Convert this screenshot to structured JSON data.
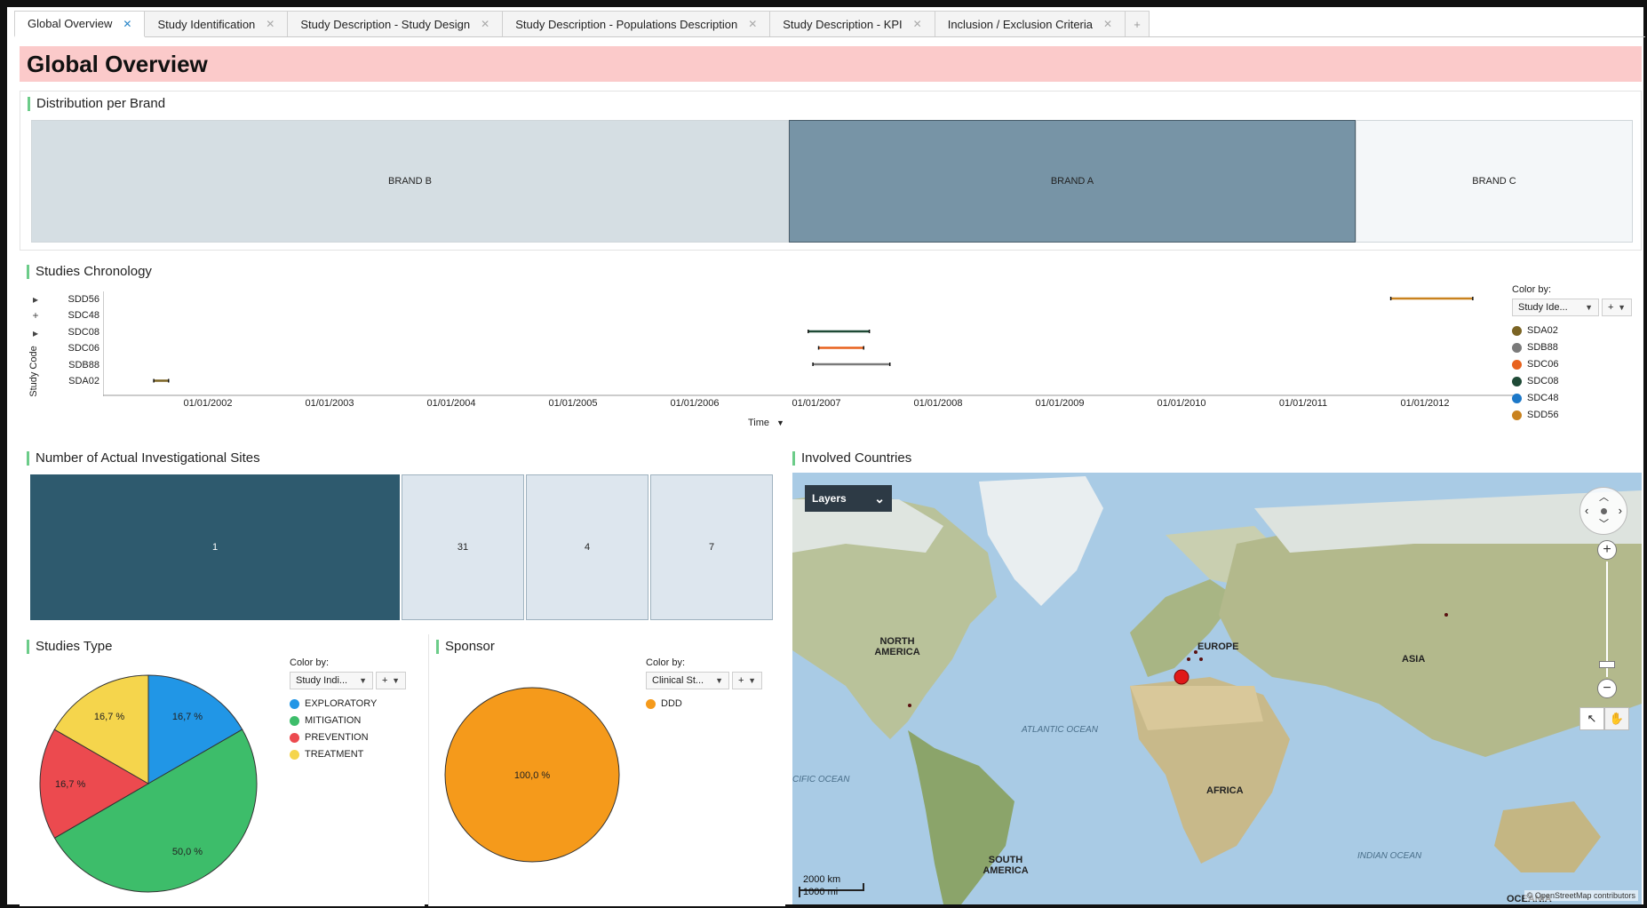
{
  "tabs": [
    {
      "label": "Global Overview",
      "active": true
    },
    {
      "label": "Study Identification"
    },
    {
      "label": "Study Description - Study Design"
    },
    {
      "label": "Study Description - Populations Description"
    },
    {
      "label": "Study Description - KPI"
    },
    {
      "label": "Inclusion / Exclusion Criteria"
    }
  ],
  "tab_add": "+",
  "page_title": "Global Overview",
  "brand_panel": {
    "title": "Distribution per Brand",
    "brands": [
      {
        "label": "BRAND B",
        "color": "#d5dee3"
      },
      {
        "label": "BRAND A",
        "color": "#7794a6"
      },
      {
        "label": "BRAND C",
        "color": "#f4f7f9"
      }
    ]
  },
  "chronology": {
    "title": "Studies Chronology",
    "ylabel": "Study Code",
    "xlabel": "Time",
    "color_by_label": "Color by:",
    "color_by_value": "Study Ide...",
    "studies": [
      "SDD56",
      "SDC48",
      "SDC08",
      "SDC06",
      "SDB88",
      "SDA02"
    ],
    "xticks": [
      "01/01/2002",
      "01/01/2003",
      "01/01/2004",
      "01/01/2005",
      "01/01/2006",
      "01/01/2007",
      "01/01/2008",
      "01/01/2009",
      "01/01/2010",
      "01/01/2011",
      "01/01/2012"
    ],
    "legend": [
      {
        "name": "SDA02",
        "color": "#7b6424"
      },
      {
        "name": "SDB88",
        "color": "#7a7a7a"
      },
      {
        "name": "SDC06",
        "color": "#e8621d"
      },
      {
        "name": "SDC08",
        "color": "#1f4a36"
      },
      {
        "name": "SDC48",
        "color": "#1c78c8"
      },
      {
        "name": "SDD56",
        "color": "#c9821f"
      }
    ]
  },
  "sites": {
    "title": "Number of Actual Investigational Sites",
    "values": [
      "1",
      "31",
      "4",
      "7"
    ]
  },
  "countries": {
    "title": "Involved Countries",
    "layers_label": "Layers",
    "labels": {
      "north_america": "NORTH AMERICA",
      "south_america": "SOUTH AMERICA",
      "europe": "EUROPE",
      "asia": "ASIA",
      "africa": "AFRICA",
      "oceania": "OCEANIA"
    },
    "oceans": {
      "atlantic": "ATLANTIC OCEAN",
      "pacific": "CIFIC OCEAN",
      "indian": "INDIAN OCEAN"
    },
    "scale_km": "2000 km",
    "scale_mi": "1000 mi",
    "attribution": "© OpenStreetMap contributors"
  },
  "studies_type": {
    "title": "Studies Type",
    "color_by_label": "Color by:",
    "color_by_value": "Study Indi...",
    "slices": [
      {
        "name": "EXPLORATORY",
        "value": 16.7,
        "label": "16,7 %",
        "color": "#2196e6"
      },
      {
        "name": "MITIGATION",
        "value": 50.0,
        "label": "50,0 %",
        "color": "#3dbd6a"
      },
      {
        "name": "PREVENTION",
        "value": 16.7,
        "label": "16,7 %",
        "color": "#ec4a4f"
      },
      {
        "name": "TREATMENT",
        "value": 16.7,
        "label": "16,7 %",
        "color": "#f5d54c"
      }
    ]
  },
  "sponsor": {
    "title": "Sponsor",
    "color_by_label": "Color by:",
    "color_by_value": "Clinical St...",
    "slices": [
      {
        "name": "DDD",
        "value": 100.0,
        "label": "100,0 %",
        "color": "#f59a1b"
      }
    ]
  },
  "chart_data": [
    {
      "type": "bar",
      "title": "Distribution per Brand",
      "categories": [
        "BRAND B",
        "BRAND A",
        "BRAND C"
      ]
    },
    {
      "type": "timeline",
      "title": "Studies Chronology",
      "xlabel": "Time",
      "ylabel": "Study Code",
      "series": [
        {
          "name": "SDD56",
          "start": "2011-07-01",
          "end": "2012-03-01"
        },
        {
          "name": "SDC08",
          "start": "2006-10-01",
          "end": "2007-04-01"
        },
        {
          "name": "SDC06",
          "start": "2006-11-01",
          "end": "2007-03-15"
        },
        {
          "name": "SDB88",
          "start": "2006-10-15",
          "end": "2007-06-01"
        },
        {
          "name": "SDA02",
          "start": "2001-06-01",
          "end": "2001-07-15"
        }
      ]
    },
    {
      "type": "pie",
      "title": "Studies Type",
      "categories": [
        "EXPLORATORY",
        "MITIGATION",
        "PREVENTION",
        "TREATMENT"
      ],
      "values": [
        16.7,
        50.0,
        16.7,
        16.7
      ]
    },
    {
      "type": "pie",
      "title": "Sponsor",
      "categories": [
        "DDD"
      ],
      "values": [
        100.0
      ]
    }
  ]
}
